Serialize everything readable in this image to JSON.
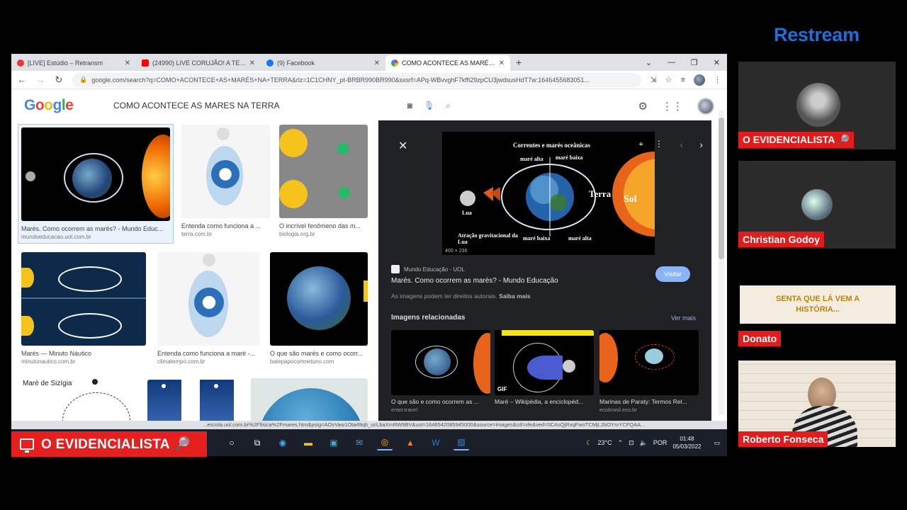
{
  "browser": {
    "tabs": [
      {
        "label": "[LIVE] Estúdio – Retransm",
        "favicon_color": "#e53935"
      },
      {
        "label": "(24990) LIVE CORUJÃO! A TERRA",
        "favicon_color": "#ff0000"
      },
      {
        "label": "(9) Facebook",
        "favicon_color": "#1877f2"
      },
      {
        "label": "COMO ACONTECE AS MARÉS N",
        "favicon_color": "#4285f4"
      }
    ],
    "url": "google.com/search?q=COMO+ACONTECE+AS+MARÉS+NA+TERRA&rlz=1C1CHNY_pt-BRBR990BR990&sxsrf=APq-WBvvghF7kffi29zpCU3jwdsusHdT7w:1646455683051..."
  },
  "google": {
    "logo": [
      "G",
      "o",
      "o",
      "g",
      "l",
      "e"
    ],
    "query": "COMO ACONTECE AS MARES NA TERRA"
  },
  "results": [
    {
      "caption": "Marés. Como ocorrem as marés? - Mundo Educ...",
      "source": "mundoeducacao.uol.com.br"
    },
    {
      "caption": "Entenda como funciona a ...",
      "source": "terra.com.br"
    },
    {
      "caption": "O incrível fenômeno das m...",
      "source": "biologia.org.br"
    },
    {
      "caption": "Marés — Minuto Náutico",
      "source": "minutonautico.com.br"
    },
    {
      "caption": "Entenda como funciona a maré -...",
      "source": "climatempo.com.br"
    },
    {
      "caption": "O que são marés e como ocorr...",
      "source": "batepapocomnetuno.com"
    },
    {
      "caption": "Maré de Sizígia",
      "source": ""
    }
  ],
  "preview": {
    "image_labels": {
      "title": "Correntes e marés oceânicas",
      "mare_alta_1": "maré alta",
      "mare_baixa_1": "maré baixa",
      "terra": "Terra",
      "sol": "Sol",
      "lua": "Lua",
      "atracao": "Atração gravitacional da Lua",
      "mare_baixa_2": "maré baixa",
      "mare_alta_2": "maré alta",
      "size": "400 × 236"
    },
    "site": "Mundo Educação - UOL",
    "title": "Marés. Como ocorrem as marés? - Mundo Educação",
    "visit_label": "Visitar",
    "rights": "As imagens podem ter direitos autorais.",
    "learn_more": "Saiba mais",
    "related_heading": "Imagens relacionadas",
    "see_more": "Ver mais",
    "related": [
      {
        "caption": "O que são e como ocorrem as ...",
        "source": "enter.travel"
      },
      {
        "caption": "Maré – Wikipédia, a enciclopéd...",
        "source": "",
        "badge": "GIF"
      },
      {
        "caption": "Marinas de Paraty: Termos Rel...",
        "source": "ecobrasil.eco.br"
      }
    ]
  },
  "status_url": "...escola.uol.com.br%2Ffisica%2Fmares.htm&psig=AOvVaw1Ota49qb_ucLbaXmRW9BV&ust=1646542085945000&source=images&cd=vfe&ved=0CAsQjRxqFwoTCMjL2bOYrvYCFQAA...",
  "taskbar": {
    "temp": "23°C",
    "lang": "POR",
    "time": "01:48",
    "date": "05/03/2022"
  },
  "overlay": {
    "banner": "O EVIDENCIALISTA 🔎",
    "brand": "Restream"
  },
  "participants": [
    {
      "name": "O EVIDENCIALISTA 🔎"
    },
    {
      "name": "Christian Godoy"
    },
    {
      "name": "Donato",
      "card_text": "SENTA QUE LÁ VEM A HISTÓRIA..."
    },
    {
      "name": "Roberto Fonseca"
    }
  ],
  "colors": {
    "accent_red": "#e21b1b",
    "restream_blue": "#1e6fd9",
    "google_blue": "#4285f4"
  }
}
